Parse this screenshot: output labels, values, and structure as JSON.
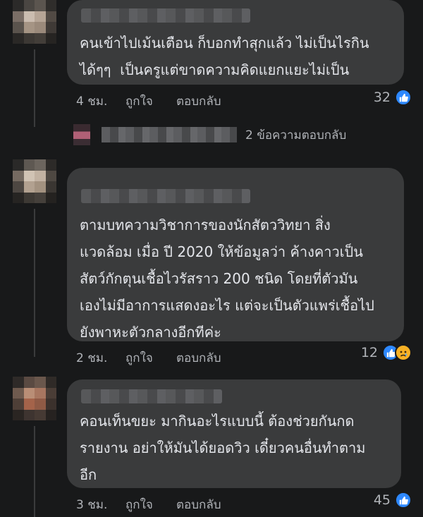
{
  "comments": [
    {
      "text": "คนเข้าไปเม้นเตือน ก็บอกทำสุกแล้ว ไม่เป็นไรกิน\nได้ๆๆ  เป็นครูแต่ขาดความคิดแยกแยะไม่เป็น",
      "time": "4 ชม.",
      "like_label": "ถูกใจ",
      "reply_label": "ตอบกลับ",
      "reaction_count": "32",
      "reactions": [
        "like-icon"
      ],
      "replies_summary": "2 ข้อความตอบกลับ"
    },
    {
      "text": "ตามบทความวิชาการของนักสัตววิทยา สิ่ง\nแวดล้อม เมื่อ ปี 2020 ให้ข้อมูลว่า ค้างคาวเป็น\nสัตว์กักตุนเชื้อไวรัสราว 200 ชนิด โดยที่ตัวมัน\nเองไม่มีอาการแสดงอะไร แต่จะเป็นตัวแพร่เชื้อไป\nยังพาหะตัวกลางอีกทีค่ะ",
      "time": "2 ชม.",
      "like_label": "ถูกใจ",
      "reply_label": "ตอบกลับ",
      "reaction_count": "12",
      "reactions": [
        "like-icon",
        "sad-icon"
      ]
    },
    {
      "text": "คอนเท็นขยะ มากินอะไรแบบนี้ ต้องช่วยกันกด\nรายงาน อย่าให้มันได้ยอดวิว เดี๋ยวคนอื่นทำตาม\nอีก",
      "time": "3 ชม.",
      "like_label": "ถูกใจ",
      "reply_label": "ตอบกลับ",
      "reaction_count": "45",
      "reactions": [
        "like-icon"
      ]
    }
  ],
  "colors": {
    "background": "#18191a",
    "bubble": "#3a3b3c",
    "text": "#e4e6eb",
    "secondary_text": "#b0b3b8",
    "like_blue": "#2d88ff",
    "sad_yellow": "#f7b125"
  }
}
